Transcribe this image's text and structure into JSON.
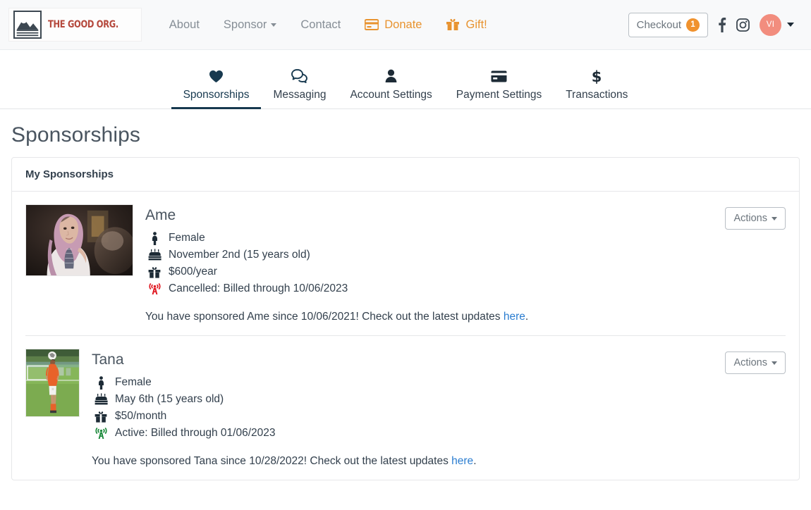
{
  "navbar": {
    "brand": {
      "text": "THE GOOD ORG.",
      "icon": "mountain-logo-icon"
    },
    "links": [
      {
        "label": "About",
        "icon": null,
        "accent": false,
        "caret": false
      },
      {
        "label": "Sponsor",
        "icon": null,
        "accent": false,
        "caret": true
      },
      {
        "label": "Contact",
        "icon": null,
        "accent": false,
        "caret": false
      },
      {
        "label": "Donate",
        "icon": "credit-card-icon",
        "accent": true,
        "caret": false
      },
      {
        "label": "Gift!",
        "icon": "gift-icon",
        "accent": true,
        "caret": false
      }
    ],
    "checkout": {
      "label": "Checkout",
      "count": "1"
    },
    "social": [
      {
        "name": "facebook-icon"
      },
      {
        "name": "instagram-icon"
      }
    ],
    "avatar": {
      "initials": "VI"
    },
    "accent_color": "#e8932f",
    "badge_color": "#f0922e",
    "avatar_color": "#f28d7e"
  },
  "tabs": [
    {
      "label": "Sponsorships",
      "icon": "heart-icon",
      "active": true
    },
    {
      "label": "Messaging",
      "icon": "chat-icon",
      "active": false
    },
    {
      "label": "Account Settings",
      "icon": "person-icon",
      "active": false
    },
    {
      "label": "Payment Settings",
      "icon": "credit-card-icon",
      "active": false
    },
    {
      "label": "Transactions",
      "icon": "dollar-icon",
      "active": false
    }
  ],
  "page": {
    "title": "Sponsorships",
    "card_header": "My Sponsorships"
  },
  "sponsorships": [
    {
      "name": "Ame",
      "photo": "portrait-woman-pink-hijab",
      "photo_shape": "wide",
      "gender": "Female",
      "gender_icon": "female-person-icon",
      "birthday": "November 2nd (15 years old)",
      "birthday_icon": "birthday-cake-icon",
      "amount": "$600/year",
      "amount_icon": "gift-icon",
      "status": "Cancelled: Billed through 10/06/2023",
      "status_icon": "broadcast-tower-icon",
      "status_color": "#e01b24",
      "note_prefix": "You have sponsored Ame since 10/06/2021! Check out the latest updates ",
      "note_link": "here",
      "note_suffix": ".",
      "actions_label": "Actions"
    },
    {
      "name": "Tana",
      "photo": "soccer-player-orange-jersey",
      "photo_shape": "tall",
      "gender": "Female",
      "gender_icon": "female-person-icon",
      "birthday": "May 6th (15 years old)",
      "birthday_icon": "birthday-cake-icon",
      "amount": "$50/month",
      "amount_icon": "gift-icon",
      "status": "Active: Billed through 01/06/2023",
      "status_icon": "broadcast-tower-icon",
      "status_color": "#1d8a3c",
      "note_prefix": "You have sponsored Tana since 10/28/2022! Check out the latest updates ",
      "note_link": "here",
      "note_suffix": ".",
      "actions_label": "Actions"
    }
  ]
}
